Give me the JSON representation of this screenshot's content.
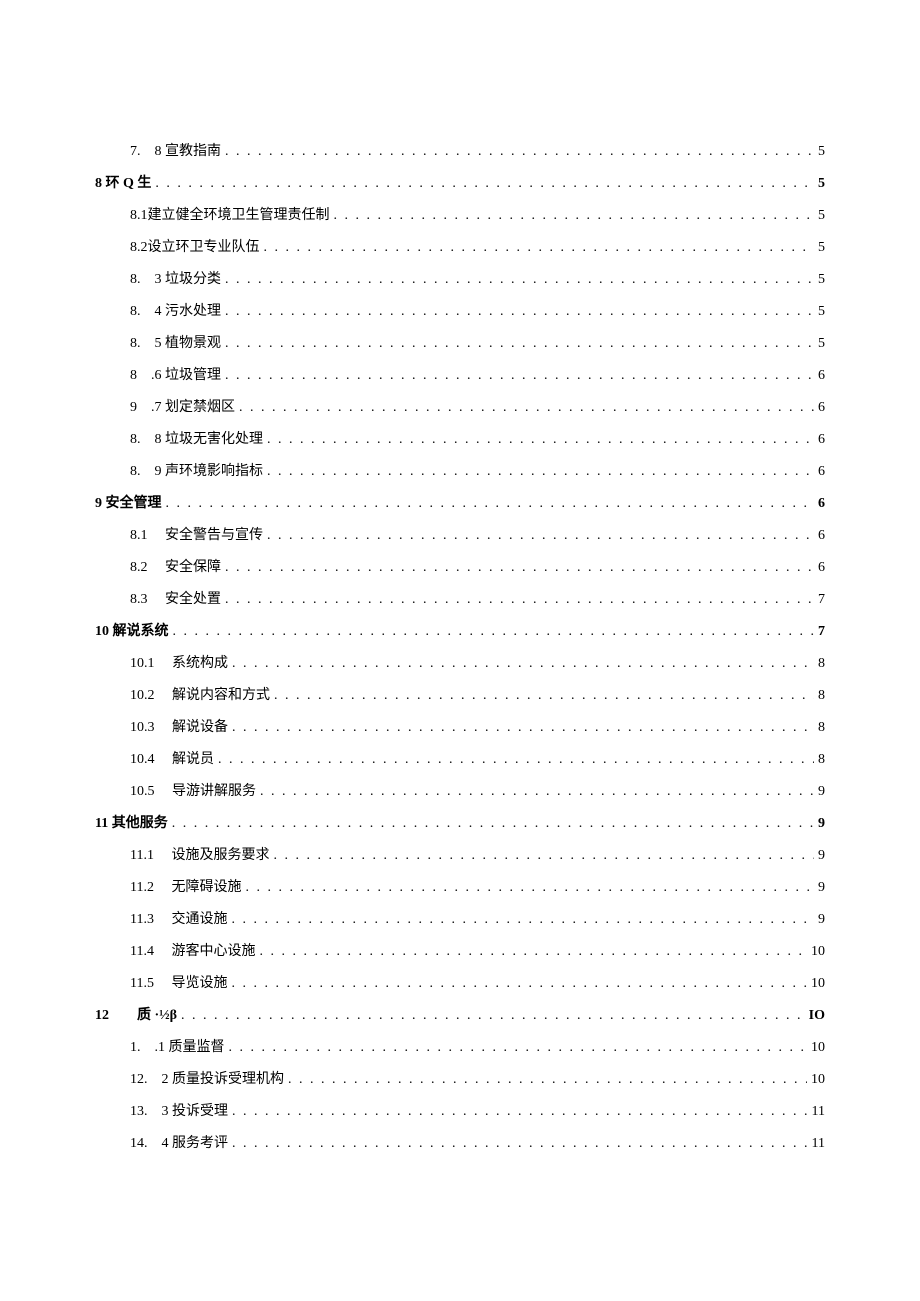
{
  "toc": [
    {
      "level": "2",
      "num": "7.",
      "title": "　8 宣教指南",
      "page": "5",
      "bold": false
    },
    {
      "level": "1",
      "num": "8 环 Q 生",
      "title": "",
      "page": "5",
      "bold": true
    },
    {
      "level": "2",
      "num": "8.1",
      "title": " 建立健全环境卫生管理责任制",
      "page": "5",
      "bold": false
    },
    {
      "level": "2",
      "num": "8.2",
      "title": " 设立环卫专业队伍",
      "page": "5",
      "bold": false
    },
    {
      "level": "2",
      "num": "8.",
      "title": "　3 垃圾分类",
      "page": "5",
      "bold": false
    },
    {
      "level": "2",
      "num": "8.",
      "title": "　4 污水处理",
      "page": "5",
      "bold": false
    },
    {
      "level": "2",
      "num": "8.",
      "title": "　5 植物景观",
      "page": "5",
      "bold": false
    },
    {
      "level": "2",
      "num": "8",
      "title": "　.6 垃圾管理",
      "page": "6",
      "bold": false
    },
    {
      "level": "2",
      "num": "9",
      "title": "　.7 划定禁烟区",
      "page": "6",
      "bold": false
    },
    {
      "level": "2",
      "num": "8.",
      "title": "　8 垃圾无害化处理",
      "page": "6",
      "bold": false
    },
    {
      "level": "2",
      "num": "8.",
      "title": "　9 声环境影响指标",
      "page": "6",
      "bold": false
    },
    {
      "level": "1",
      "num": "9 安全管理",
      "title": "",
      "page": "6",
      "bold": true
    },
    {
      "level": "2",
      "num": "8.1",
      "title": "　 安全警告与宣传",
      "page": "6",
      "bold": false
    },
    {
      "level": "2",
      "num": "8.2",
      "title": "　 安全保障",
      "page": "6",
      "bold": false
    },
    {
      "level": "2",
      "num": "8.3",
      "title": "　 安全处置",
      "page": "7",
      "bold": false
    },
    {
      "level": "1",
      "num": "10 解说系统",
      "title": "",
      "page": "7",
      "bold": true
    },
    {
      "level": "2",
      "num": "10.1",
      "title": "　 系统构成",
      "page": "8",
      "bold": false
    },
    {
      "level": "2",
      "num": "10.2",
      "title": "　 解说内容和方式",
      "page": "8",
      "bold": false
    },
    {
      "level": "2",
      "num": "10.3",
      "title": "　 解说设备",
      "page": "8",
      "bold": false
    },
    {
      "level": "2",
      "num": "10.4",
      "title": "　 解说员",
      "page": "8",
      "bold": false
    },
    {
      "level": "2",
      "num": "10.5",
      "title": "　 导游讲解服务",
      "page": "9",
      "bold": false
    },
    {
      "level": "1",
      "num": "11 其他服务",
      "title": "",
      "page": "9",
      "bold": true
    },
    {
      "level": "2",
      "num": "11.1",
      "title": "　 设施及服务要求",
      "page": "9",
      "bold": false
    },
    {
      "level": "2",
      "num": "11.2",
      "title": "　 无障碍设施",
      "page": "9",
      "bold": false
    },
    {
      "level": "2",
      "num": "11.3",
      "title": "　 交通设施",
      "page": "9",
      "bold": false
    },
    {
      "level": "2",
      "num": "11.4",
      "title": "　 游客中心设施",
      "page": "10",
      "bold": false
    },
    {
      "level": "2",
      "num": "11.5",
      "title": "　 导览设施",
      "page": "10",
      "bold": false
    },
    {
      "level": "1b",
      "num": "12",
      "title": "　　质 ·½β",
      "page": "IO",
      "bold": true
    },
    {
      "level": "2",
      "num": "1.",
      "title": "　.1 质量监督",
      "page": "10",
      "bold": false
    },
    {
      "level": "2",
      "num": "12.",
      "title": "　2 质量投诉受理机构",
      "page": "10",
      "bold": false
    },
    {
      "level": "2",
      "num": "13.",
      "title": "　3 投诉受理",
      "page": "11",
      "bold": false
    },
    {
      "level": "2",
      "num": "14.",
      "title": "　4 服务考评",
      "page": "11",
      "bold": false
    }
  ],
  "dots": ". . . . . . . . . . . . . . . . . . . . . . . . . . . . . . . . . . . . . . . . . . . . . . . . . . . . . . . . . . . . . . . . . . . . . . . . . . . . . . . . . . . . . . . . . . . . . . . . . . . . . . . . . . . . . . . . . . . . . . . ."
}
